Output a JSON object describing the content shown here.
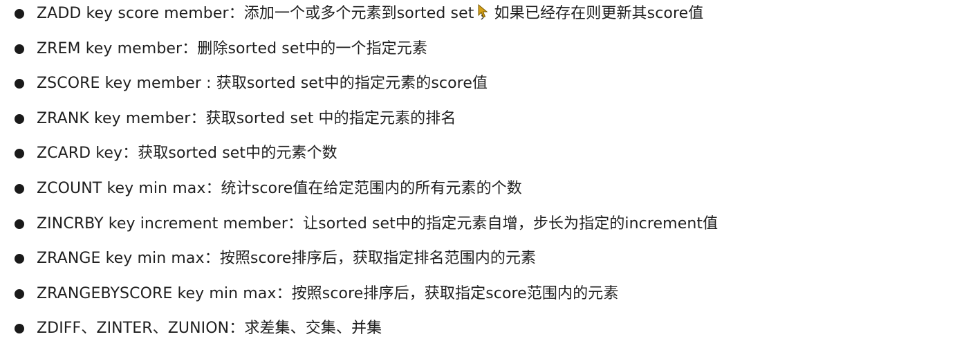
{
  "commands": [
    {
      "text": "ZADD key score member：添加一个或多个元素到sorted set ，如果已经存在则更新其score值"
    },
    {
      "text": "ZREM key member：删除sorted set中的一个指定元素"
    },
    {
      "text": "ZSCORE key member : 获取sorted set中的指定元素的score值"
    },
    {
      "text": "ZRANK key member：获取sorted set 中的指定元素的排名"
    },
    {
      "text": "ZCARD key：获取sorted set中的元素个数"
    },
    {
      "text": "ZCOUNT key min max：统计score值在给定范围内的所有元素的个数"
    },
    {
      "text": "ZINCRBY key increment member：让sorted set中的指定元素自增，步长为指定的increment值"
    },
    {
      "text": "ZRANGE key min max：按照score排序后，获取指定排名范围内的元素"
    },
    {
      "text": "ZRANGEBYSCORE key min max：按照score排序后，获取指定score范围内的元素"
    },
    {
      "text": "ZDIFF、ZINTER、ZUNION：求差集、交集、并集"
    }
  ],
  "colors": {
    "text": "#1f1f1f",
    "bullet": "#1a1a1a",
    "cursor": "#d4a017"
  }
}
